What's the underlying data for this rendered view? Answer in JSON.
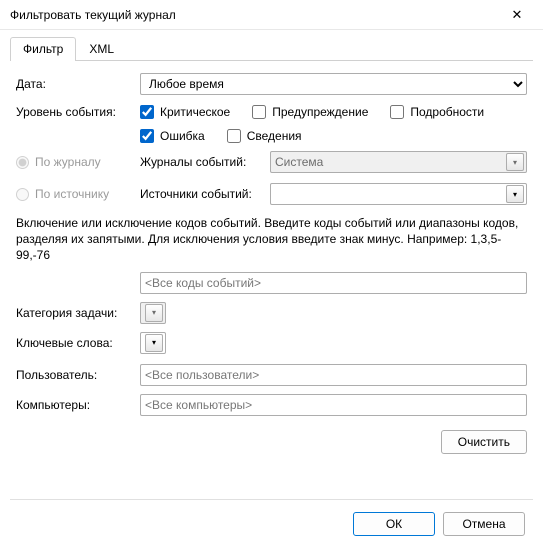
{
  "window": {
    "title": "Фильтровать текущий журнал"
  },
  "tabs": {
    "filter": "Фильтр",
    "xml": "XML"
  },
  "labels": {
    "date": "Дата:",
    "level": "Уровень события:",
    "by_log": "По журналу",
    "by_source": "По источнику",
    "event_logs": "Журналы событий:",
    "event_sources": "Источники событий:",
    "task_category": "Категория задачи:",
    "keywords": "Ключевые слова:",
    "user": "Пользователь:",
    "computers": "Компьютеры:"
  },
  "date": {
    "selected": "Любое время"
  },
  "levels": {
    "critical": "Критическое",
    "warning": "Предупреждение",
    "verbose": "Подробности",
    "error": "Ошибка",
    "information": "Сведения"
  },
  "event_logs": {
    "value": "Система"
  },
  "help_text": "Включение или исключение кодов событий. Введите коды событий или диапазоны кодов, разделяя их запятыми. Для исключения условия введите знак минус. Например: 1,3,5-99,-76",
  "event_ids": {
    "placeholder": "<Все коды событий>"
  },
  "user": {
    "placeholder": "<Все пользователи>"
  },
  "computers": {
    "placeholder": "<Все компьютеры>"
  },
  "buttons": {
    "clear": "Очистить",
    "ok": "ОК",
    "cancel": "Отмена"
  }
}
